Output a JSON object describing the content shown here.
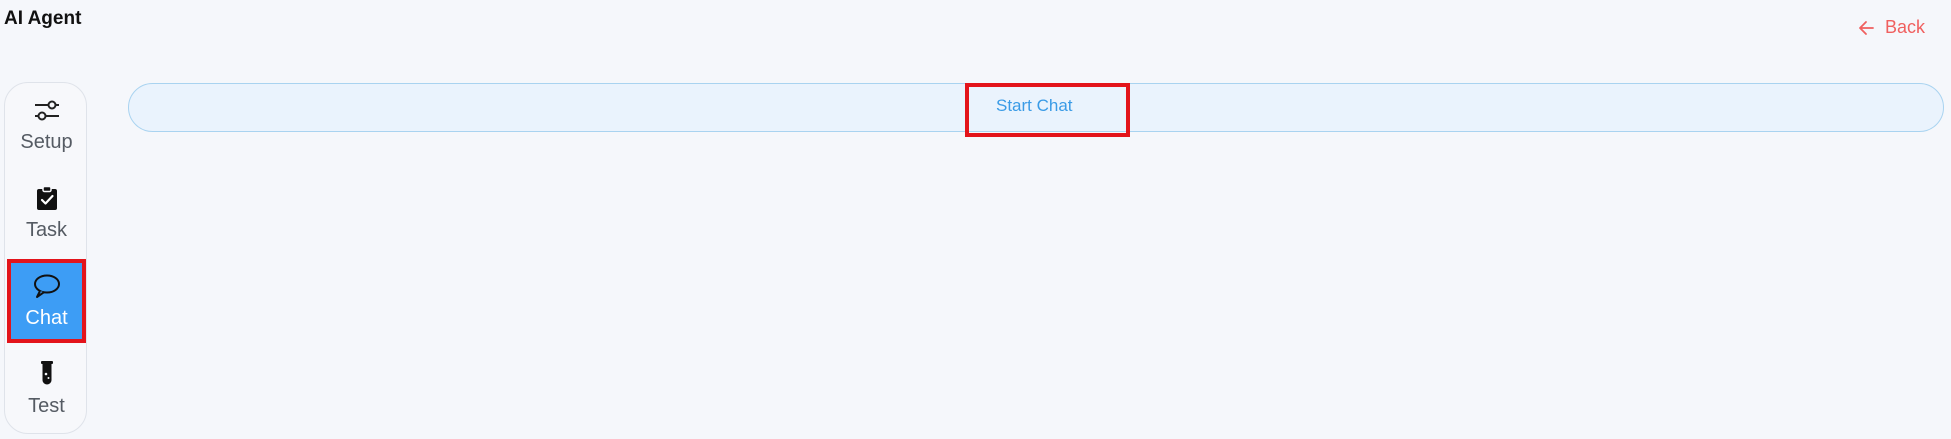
{
  "app": {
    "title": "AI Agent"
  },
  "header": {
    "back_label": "Back",
    "back_icon": "arrow-left-icon"
  },
  "sidebar": {
    "items": [
      {
        "label": "Setup",
        "icon": "sliders-icon",
        "active": false
      },
      {
        "label": "Task",
        "icon": "clipboard-check-icon",
        "active": false
      },
      {
        "label": "Chat",
        "icon": "chat-bubble-icon",
        "active": true
      },
      {
        "label": "Test",
        "icon": "test-tube-icon",
        "active": false
      }
    ]
  },
  "main": {
    "start_chat_label": "Start Chat"
  },
  "colors": {
    "background": "#f5f7fb",
    "accent": "#3d9df5",
    "back_link": "#f0605f",
    "highlight": "#e3141b",
    "chat_bar_fill": "#eaf3fd",
    "chat_bar_border": "#a9d3f0"
  }
}
